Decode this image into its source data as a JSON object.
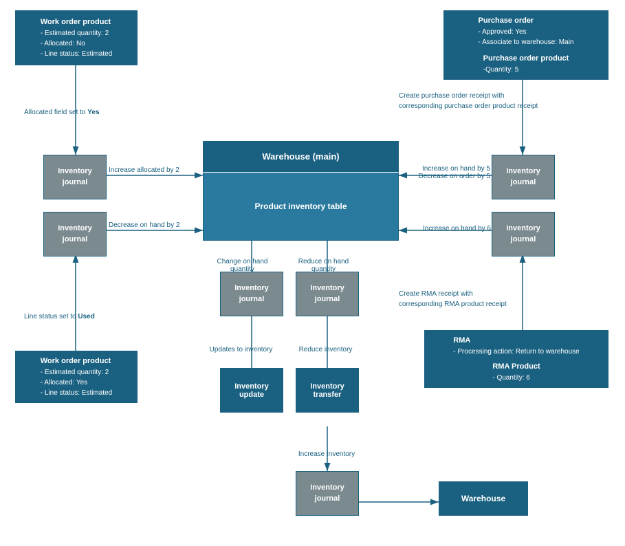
{
  "boxes": {
    "work_order_top": {
      "label": "Work order product",
      "lines": [
        "- Estimated quantity: 2",
        "- Allocated: No",
        "- Line status: Estimated"
      ]
    },
    "work_order_bottom": {
      "label": "Work order product",
      "lines": [
        "- Estimated quantity: 2",
        "- Allocated: Yes",
        "- Line status: Estimated"
      ]
    },
    "purchase_order": {
      "label": "Purchase order",
      "lines": [
        "- Approved: Yes",
        "- Associate to warehouse: Main"
      ]
    },
    "purchase_order_product": {
      "label": "Purchase order product",
      "lines": [
        "-Quantity: 5"
      ]
    },
    "rma": {
      "label": "RMA",
      "lines": [
        "- Processing action: Return to warehouse"
      ]
    },
    "rma_product": {
      "label": "RMA Product",
      "lines": [
        "- Quantity: 6"
      ]
    },
    "warehouse_main": "Warehouse (main)",
    "product_inventory": "Product inventory table",
    "warehouse": "Warehouse",
    "inv_journal_1": "Inventory\njournal",
    "inv_journal_2": "Inventory\njournal",
    "inv_journal_3": "Inventory\njournal",
    "inv_journal_4": "Inventory\njournal",
    "inv_journal_5": "Inventory\njournal",
    "inv_journal_6": "Inventory\njournal",
    "inv_journal_7": "Inventory\njournal",
    "inventory_update": "Inventory\nupdate",
    "inventory_transfer": "Inventory\ntransfer"
  },
  "arrow_labels": {
    "allocated_yes": "Allocated field set to Yes",
    "increase_allocated": "Increase allocated by 2",
    "decrease_on_hand": "Decrease on hand by 2",
    "line_status_used": "Line status set to Used",
    "change_on_hand": "Change on hand quantity",
    "reduce_on_hand": "Reduce on hand quantity",
    "updates_to_inventory": "Updates to inventory",
    "reduce_inventory": "Reduce inventory",
    "increase_inventory": "Increase Inventory",
    "increase_on_hand_5": "Increase on hand by 5",
    "decrease_on_order_5": "Decrease on order by 5",
    "increase_on_hand_6": "Increase on hand by 6",
    "create_po_receipt": "Create purchase order receipt with\ncorresponding purchase order product receipt",
    "create_rma_receipt": "Create RMA receipt with\ncorresponding RMA product receipt"
  }
}
